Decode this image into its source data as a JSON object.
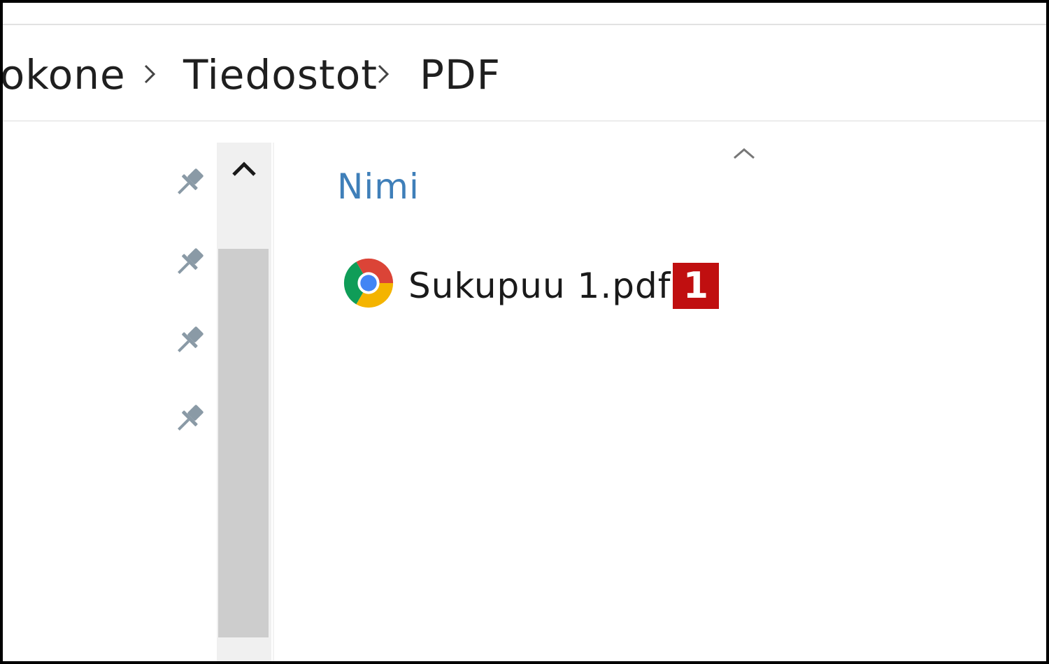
{
  "breadcrumb": {
    "items": [
      {
        "label": "tokone"
      },
      {
        "label": "Tiedostot"
      },
      {
        "label": "PDF"
      }
    ]
  },
  "file_list": {
    "column_header": "Nimi",
    "sort_direction": "ascending",
    "files": [
      {
        "name": "Sukupuu 1.pdf",
        "icon": "chrome-icon",
        "badge": "1",
        "badge_color": "#c00f10"
      }
    ]
  },
  "navigation_pane": {
    "pinned_count": 4
  },
  "colors": {
    "accent": "#3f7fb9",
    "scrollbar_thumb": "#cdcdcd",
    "scrollbar_track": "#f0f0f0"
  }
}
